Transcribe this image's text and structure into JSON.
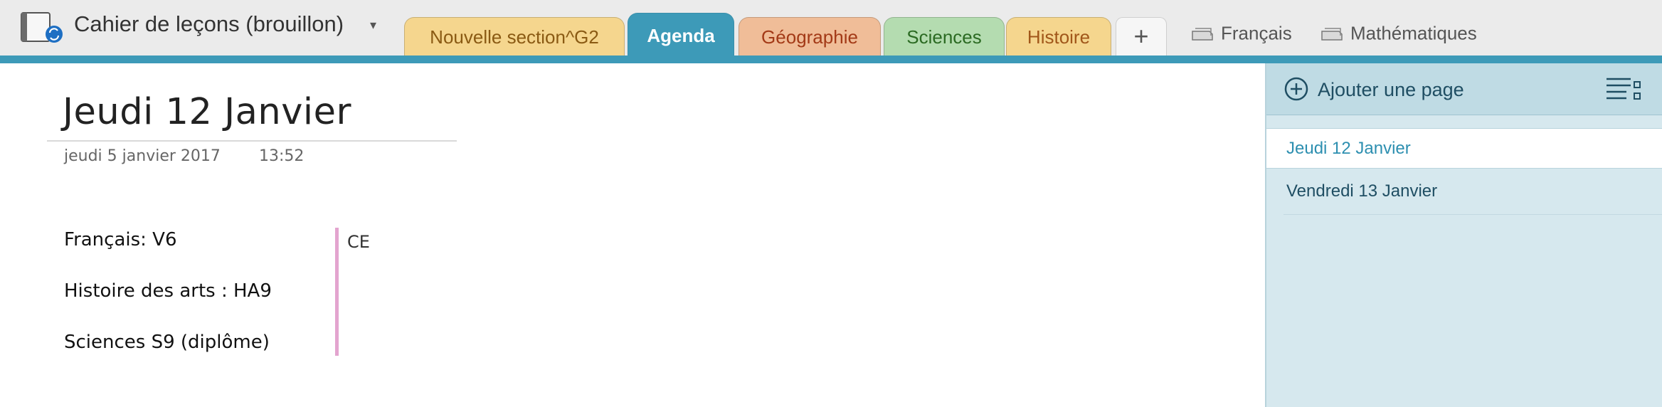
{
  "notebook": {
    "title": "Cahier de leçons (brouillon)",
    "caret": "▾",
    "icon": "notebook-sync-icon"
  },
  "tabs": [
    {
      "label": "Nouvelle section^G2",
      "color": "#f5d68e",
      "text_color": "#8a5a13"
    },
    {
      "label": "Agenda",
      "color": "#3d9ab8",
      "text_color": "#ffffff",
      "active": true
    },
    {
      "label": "Géographie",
      "color": "#f0bd98",
      "text_color": "#a33a17"
    },
    {
      "label": "Sciences",
      "color": "#b4dcb0",
      "text_color": "#2b6a22"
    },
    {
      "label": "Histoire",
      "color": "#f5d68e",
      "text_color": "#a1571a"
    }
  ],
  "add_tab": "+",
  "section_groups": [
    {
      "label": "Français",
      "icon": "section-group-icon"
    },
    {
      "label": "Mathématiques",
      "icon": "section-group-icon"
    }
  ],
  "page": {
    "title": "Jeudi 12 Janvier",
    "date": "jeudi 5 janvier 2017",
    "time": "13:52",
    "lines": [
      "Français: V6",
      "Histoire des arts : HA9",
      "Sciences S9 (diplôme)"
    ],
    "side_note": "CE",
    "bar_color": "#e3a4cf"
  },
  "page_list": {
    "add_label": "Ajouter une page",
    "items": [
      {
        "label": "Jeudi 12 Janvier",
        "selected": true
      },
      {
        "label": "Vendredi 13 Janvier",
        "selected": false
      }
    ]
  },
  "colors": {
    "accent": "#3d9ab8",
    "panel": "#d6e8ee"
  }
}
